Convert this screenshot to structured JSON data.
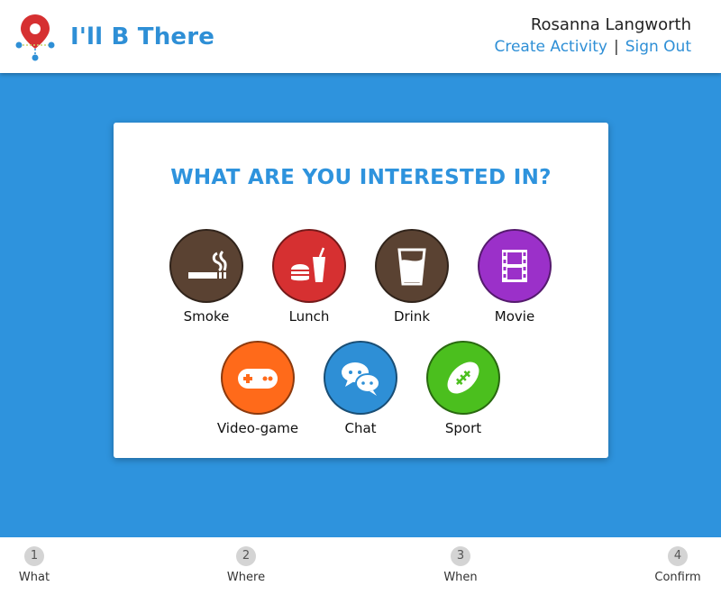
{
  "header": {
    "app_title": "I'll B There",
    "user_name": "Rosanna Langworth",
    "create_activity": "Create Activity",
    "separator": "|",
    "sign_out": "Sign Out"
  },
  "card": {
    "title": "WHAT ARE YOU INTERESTED IN?",
    "options": [
      {
        "label": "Smoke",
        "icon": "cigarette-icon",
        "color": "#5a4232"
      },
      {
        "label": "Lunch",
        "icon": "burger-drink-icon",
        "color": "#d63031"
      },
      {
        "label": "Drink",
        "icon": "glass-icon",
        "color": "#5a4232"
      },
      {
        "label": "Movie",
        "icon": "film-strip-icon",
        "color": "#9b30c9"
      },
      {
        "label": "Video-game",
        "icon": "gamepad-icon",
        "color": "#ff6a1a"
      },
      {
        "label": "Chat",
        "icon": "chat-bubbles-icon",
        "color": "#2e8fd6"
      },
      {
        "label": "Sport",
        "icon": "football-icon",
        "color": "#4bbf1e"
      }
    ]
  },
  "steps": [
    {
      "number": "1",
      "label": "What"
    },
    {
      "number": "2",
      "label": "Where"
    },
    {
      "number": "3",
      "label": "When"
    },
    {
      "number": "4",
      "label": "Confirm"
    }
  ],
  "colors": {
    "background": "#2e93dd",
    "accent": "#2e8fd6",
    "logo_pin": "#d63031"
  }
}
